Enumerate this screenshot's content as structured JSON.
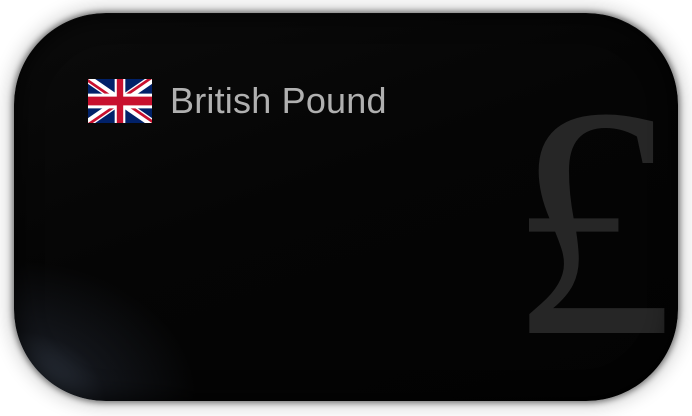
{
  "card": {
    "currency_name": "British Pound",
    "currency_symbol": "£",
    "flag_icon": "uk-flag-icon",
    "colors": {
      "card_background": "#050505",
      "text": "#b0b0b0",
      "symbol_watermark": "#2a2a2a",
      "flag_blue": "#012169",
      "flag_red": "#C8102E",
      "flag_white": "#FFFFFF"
    }
  }
}
